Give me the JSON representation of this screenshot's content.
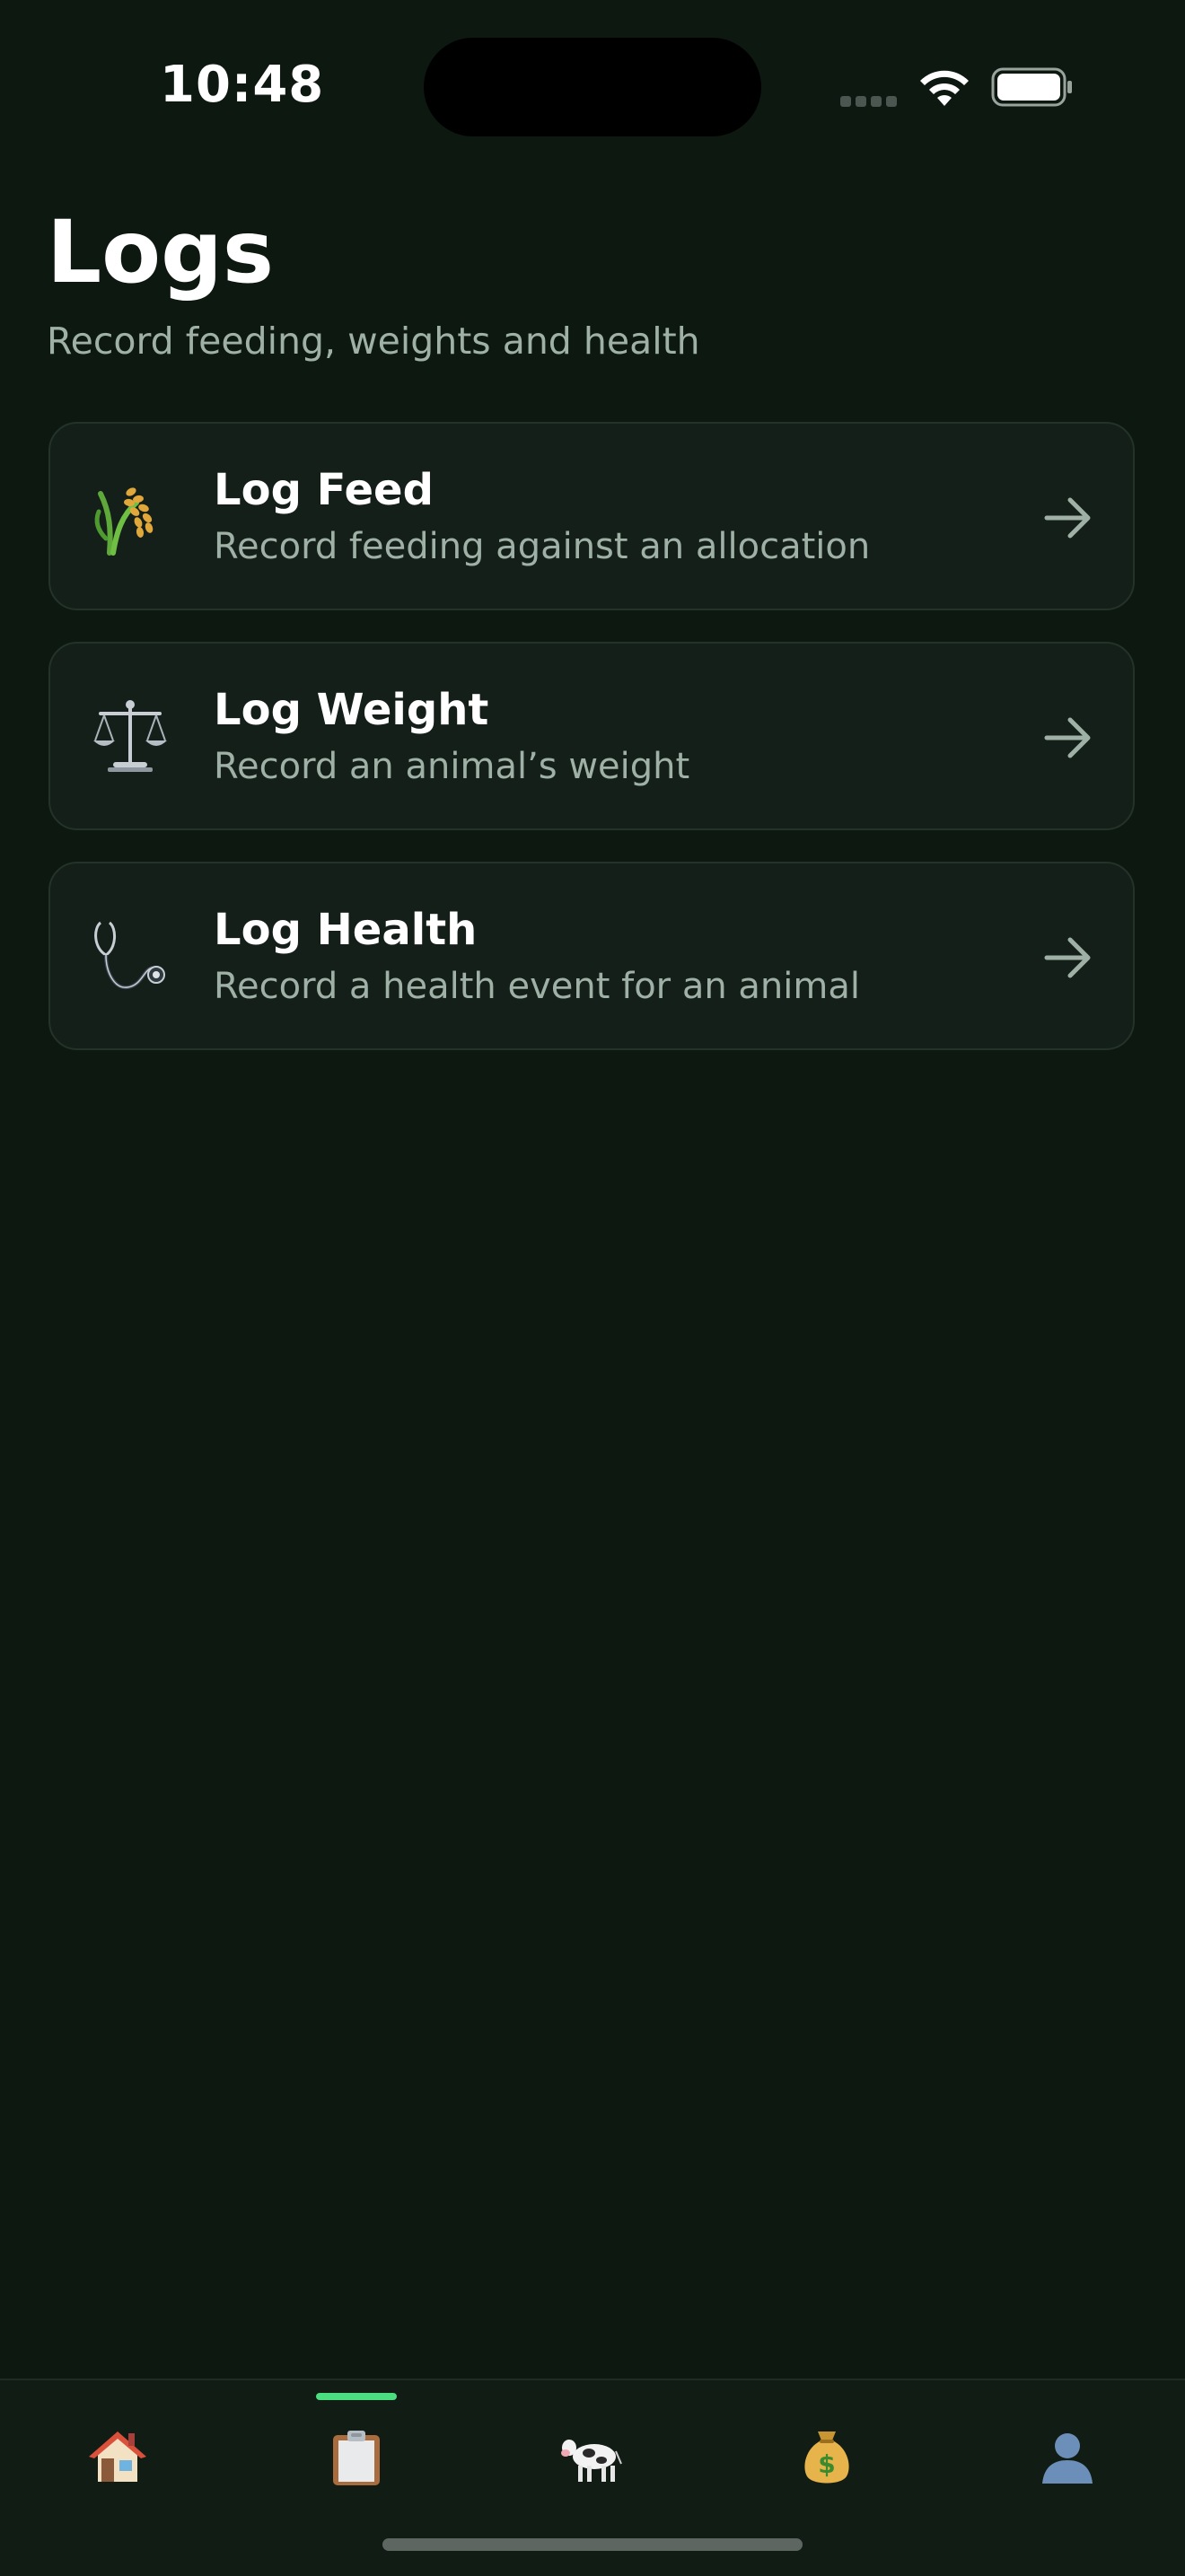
{
  "status_bar": {
    "time": "10:48"
  },
  "header": {
    "title": "Logs",
    "subtitle": "Record feeding, weights and health"
  },
  "cards": [
    {
      "icon": "rice-stalk-icon",
      "title": "Log Feed",
      "description": "Record feeding against an allocation"
    },
    {
      "icon": "balance-scale-icon",
      "title": "Log Weight",
      "description": "Record an animal’s weight"
    },
    {
      "icon": "stethoscope-icon",
      "title": "Log Health",
      "description": "Record a health event for an animal"
    }
  ],
  "tab_bar": {
    "active_index": 1,
    "items": [
      "house-icon",
      "clipboard-icon",
      "cow-icon",
      "money-bag-icon",
      "user-silhouette-icon"
    ]
  },
  "colors": {
    "background": "#0c1810",
    "card": "#141f19",
    "accent": "#4ade80",
    "muted_text": "#9fb1a6"
  }
}
